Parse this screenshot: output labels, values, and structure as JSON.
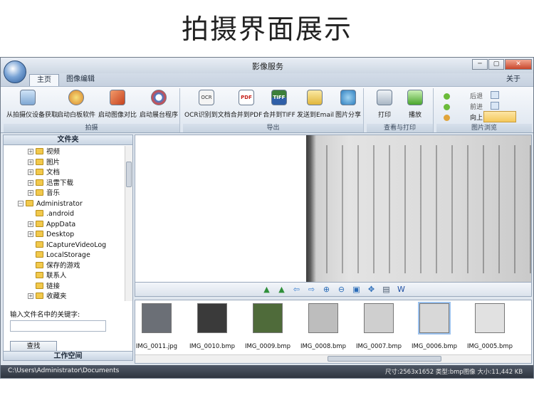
{
  "page_heading": "拍摄界面展示",
  "window": {
    "title": "影像服务",
    "buttons": {
      "minimize": "─",
      "maximize": "▢",
      "close": "✕"
    }
  },
  "tabs": {
    "home": "主页",
    "image_edit": "图像编辑",
    "about": "关于"
  },
  "ribbon": {
    "groups": {
      "capture": "拍摄",
      "export": "导出",
      "view_print": "查看与打印",
      "browse": "图片浏览"
    },
    "buttons": {
      "capture_from_device": "从拍摄仪设备获取",
      "launch_whiteboard": "启动白板软件",
      "launch_image_compare": "启动图像对比",
      "launch_exhibition": "启动展台程序",
      "ocr_to_doc": "OCR识别到文档",
      "merge_pdf": "合并到PDF",
      "merge_tiff": "合并到TIFF",
      "send_email": "发送到Email",
      "share_image": "图片分享",
      "print": "打印",
      "play": "播放",
      "back": "后退",
      "forward": "前进",
      "up": "向上"
    },
    "icon_texts": {
      "pdf": "PDF",
      "tiff": "TIFF",
      "ocr": "OCR"
    }
  },
  "sidebar": {
    "folders_header": "文件夹",
    "tree": [
      {
        "label": "视频",
        "level": 2,
        "expander": "+"
      },
      {
        "label": "图片",
        "level": 2,
        "expander": "+"
      },
      {
        "label": "文档",
        "level": 2,
        "expander": "+"
      },
      {
        "label": "迅雷下载",
        "level": 2,
        "expander": "+"
      },
      {
        "label": "音乐",
        "level": 2,
        "expander": "+"
      },
      {
        "label": "Administrator",
        "level": 1,
        "expander": "−"
      },
      {
        "label": ".android",
        "level": 2,
        "expander": ""
      },
      {
        "label": "AppData",
        "level": 2,
        "expander": "+"
      },
      {
        "label": "Desktop",
        "level": 2,
        "expander": "+"
      },
      {
        "label": "ICaptureVideoLog",
        "level": 2,
        "expander": ""
      },
      {
        "label": "LocalStorage",
        "level": 2,
        "expander": ""
      },
      {
        "label": "保存的游戏",
        "level": 2,
        "expander": ""
      },
      {
        "label": "联系人",
        "level": 2,
        "expander": ""
      },
      {
        "label": "链接",
        "level": 2,
        "expander": ""
      },
      {
        "label": "收藏夹",
        "level": 2,
        "expander": "+"
      }
    ],
    "search_label": "输入文件名中的关键字:",
    "search_value": "",
    "search_button": "查找",
    "workspace_header": "工作空间"
  },
  "thumbnails": [
    {
      "name": "IMG_0011.jpg",
      "selected": false,
      "color": "#6b6f76"
    },
    {
      "name": "IMG_0010.bmp",
      "selected": false,
      "color": "#3a3a3a"
    },
    {
      "name": "IMG_0009.bmp",
      "selected": false,
      "color": "#4f6b3a"
    },
    {
      "name": "IMG_0008.bmp",
      "selected": false,
      "color": "#bdbdbd"
    },
    {
      "name": "IMG_0007.bmp",
      "selected": false,
      "color": "#cfcfcf"
    },
    {
      "name": "IMG_0006.bmp",
      "selected": true,
      "color": "#d8d8d8"
    },
    {
      "name": "IMG_0005.bmp",
      "selected": false,
      "color": "#e1e1e1"
    }
  ],
  "navigation_icons": [
    "rotate-left-icon",
    "rotate-right-icon",
    "arrow-left-icon",
    "arrow-right-icon",
    "zoom-in-icon",
    "zoom-out-icon",
    "fit-icon",
    "move-icon",
    "page-icon",
    "word-icon"
  ],
  "status": {
    "path": "C:\\Users\\Administrator\\Documents",
    "info": "尺寸:2563x1652 类型:bmp图像 大小:11,442 KB"
  },
  "colors": {
    "accent": "#2b5b9a",
    "statusbar": "#2d333d",
    "selection": "#9cc2ee"
  }
}
